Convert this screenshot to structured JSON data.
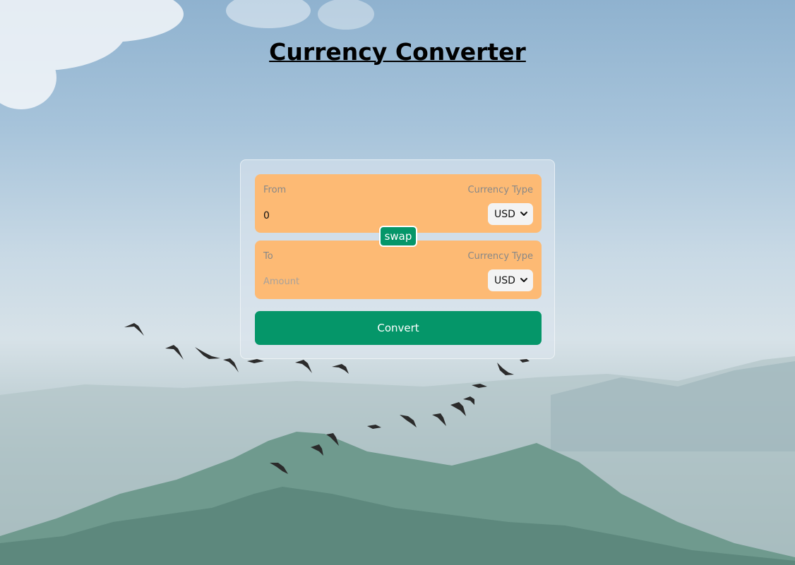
{
  "page": {
    "title": "Currency Converter"
  },
  "converter": {
    "from": {
      "label": "From",
      "currency_label": "Currency Type",
      "amount_value": "0",
      "currency": "USD"
    },
    "to": {
      "label": "To",
      "currency_label": "Currency Type",
      "amount_placeholder": "Amount",
      "currency": "USD"
    },
    "swap_label": "swap",
    "convert_label": "Convert"
  },
  "colors": {
    "panel": "#fdba74",
    "accent": "#059669",
    "text": "#000000"
  },
  "icons": {
    "select_arrow": "chevron-down-icon"
  }
}
